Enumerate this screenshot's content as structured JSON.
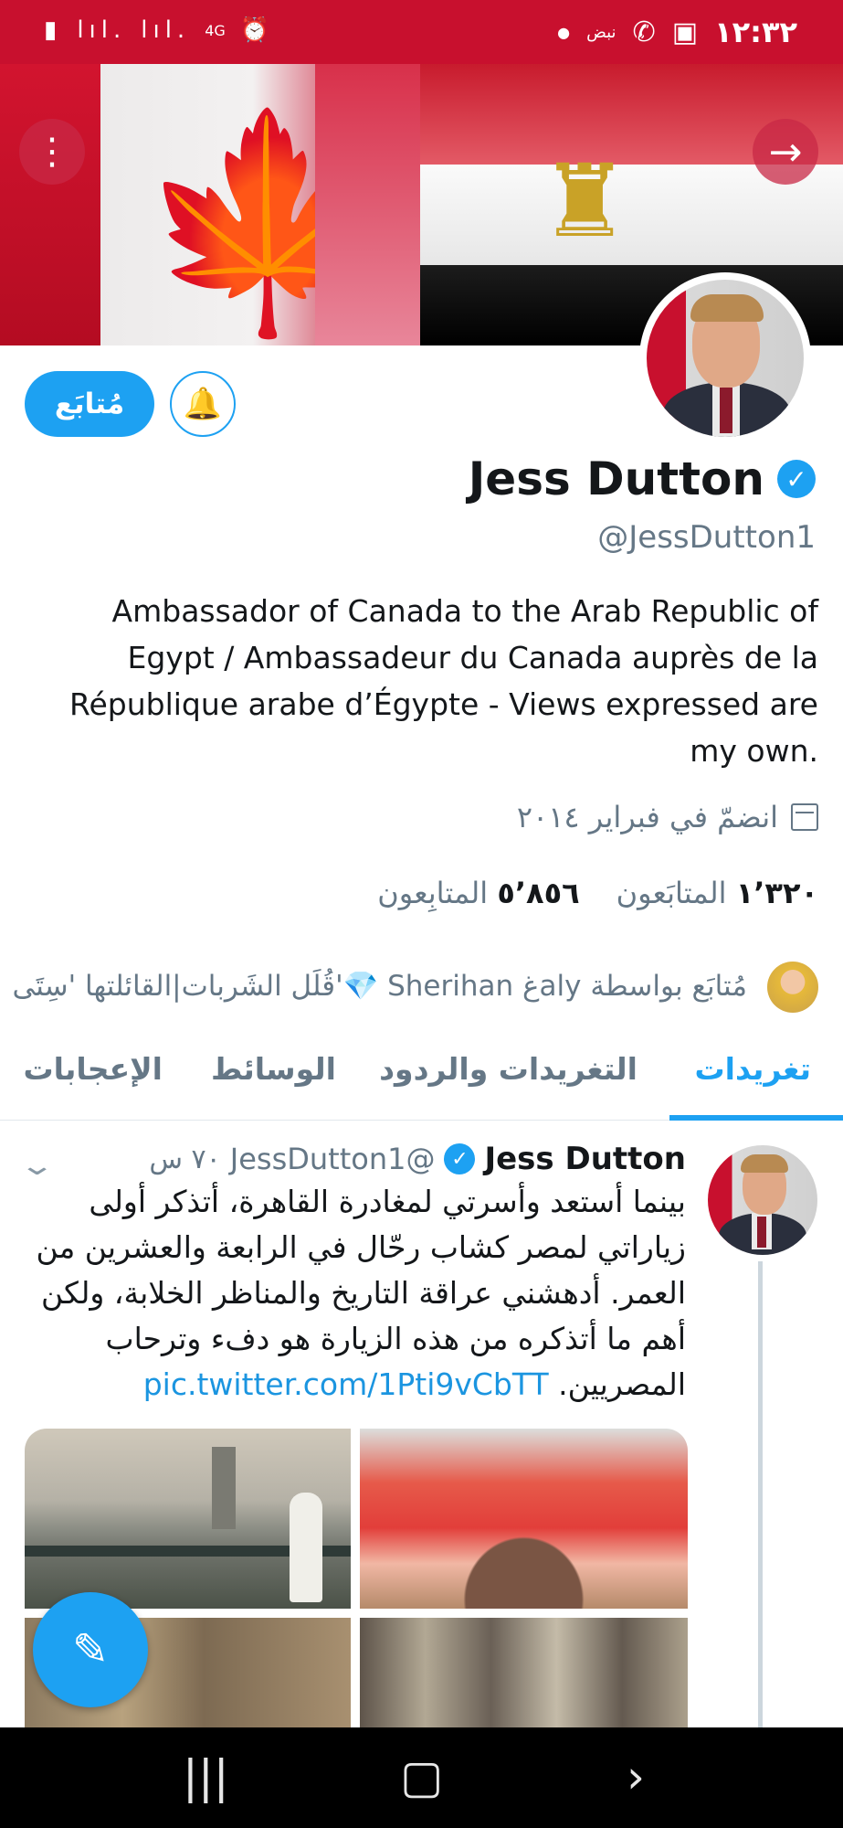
{
  "status_bar": {
    "time": "١٢:٣٢",
    "network_label": "نبض",
    "signal_text": "4G",
    "icons": [
      "battery-icon",
      "signal-icon",
      "alarm-icon",
      "dot-icon",
      "whatsapp-icon",
      "gallery-icon"
    ]
  },
  "banner": {
    "menu_icon": "more-vertical-icon",
    "next_icon": "arrow-right-icon"
  },
  "profile": {
    "follow_label": "مُتابَع",
    "name": "Jess Dutton",
    "handle": "@JessDutton1",
    "bio": "Ambassador of Canada to the Arab Republic of Egypt / Ambassadeur du Canada auprès de la République arabe d’Égypte - Views expressed are my own.",
    "joined": "انضمّ في فبراير ٢٠١٤",
    "following_count": "١٬٣٢٠",
    "following_label": "المتابَعون",
    "followers_count": "٥٬٨٥٦",
    "followers_label": "المتابِعون",
    "followed_by": "مُتابَع بواسطة alyغ Sherihan 💎'قُلَل الشَربات|القائلتها 'سِتَى"
  },
  "tabs": [
    {
      "label": "تغريدات",
      "active": true
    },
    {
      "label": "التغريدات والردود",
      "active": false
    },
    {
      "label": "الوسائط",
      "active": false
    },
    {
      "label": "الإعجابات",
      "active": false
    }
  ],
  "tweet": {
    "name": "Jess Dutton",
    "handle": "@JessDutton1",
    "time": "٧٠ س",
    "text": "بينما أستعد وأسرتي لمغادرة القاهرة، أتذكر أولى زياراتي لمصر كشاب رحّال في الرابعة والعشرين من العمر. أدهشني عراقة التاريخ والمناظر الخلابة، ولكن أهم ما أتذكره من هذه الزيارة هو دفء وترحاب المصريين.",
    "link": "pic.twitter.com/1Pti9vCbTT"
  },
  "colors": {
    "accent": "#1da1f2",
    "status_bar": "#c8102e",
    "secondary_text": "#657786"
  }
}
